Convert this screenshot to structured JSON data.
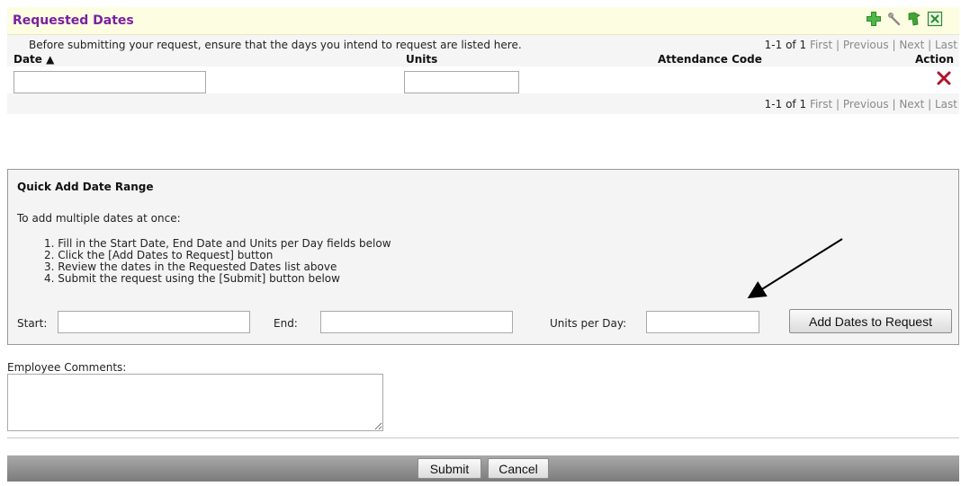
{
  "requested_dates": {
    "title": "Requested Dates",
    "info": "Before submitting your request, ensure that the days you intend to request are listed here.",
    "pager": {
      "count": "1-1 of 1",
      "first": "First",
      "previous": "Previous",
      "next": "Next",
      "last": "Last",
      "sep": "|"
    },
    "columns": {
      "date": "Date ▲",
      "units": "Units",
      "attendance_code": "Attendance Code",
      "action": "Action"
    },
    "row": {
      "date_value": "",
      "units_value": ""
    },
    "icons": [
      "plus-icon",
      "wrench-icon",
      "refresh-icon",
      "excel-icon",
      "delete-icon"
    ]
  },
  "quick_add": {
    "title": "Quick Add Date Range",
    "intro": "To add multiple dates at once:",
    "steps": [
      "1. Fill in the Start Date, End Date and Units per Day fields below",
      "2. Click the [Add Dates to Request] button",
      "3. Review the dates in the Requested Dates list above",
      "4. Submit the request using the [Submit] button below"
    ],
    "start_label": "Start:",
    "end_label": "End:",
    "units_per_day_label": "Units per Day:",
    "start_value": "",
    "end_value": "",
    "units_per_day_value": "",
    "add_button": "Add Dates to Request"
  },
  "comments": {
    "label": "Employee Comments:",
    "value": ""
  },
  "footer": {
    "submit": "Submit",
    "cancel": "Cancel"
  },
  "colors": {
    "title_purple": "#7a1fa2",
    "header_bg": "#fdfde2",
    "delete_red": "#b0122a",
    "link_gray": "#8a8a8a",
    "icon_green": "#3fa535"
  }
}
